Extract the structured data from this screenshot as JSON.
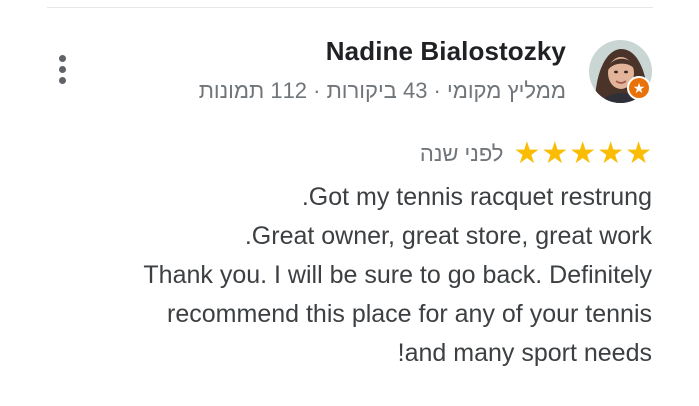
{
  "review": {
    "reviewer": {
      "name": "Nadine Bialostozky",
      "meta": "ממליץ מקומי · 43 ביקורות · 112 תמונות",
      "avatar_icon": "user-photo-icon",
      "badge_icon": "local-guide-star-icon"
    },
    "rating": {
      "stars": 5,
      "max": 5,
      "star_glyph": "★"
    },
    "time": "לפני שנה",
    "text_lines": [
      ".Got my tennis racquet restrung",
      ".Great owner, great store, great work",
      "Thank you. I will be sure to go back. Definitely",
      "recommend this place for any of your tennis",
      "!and many sport needs"
    ],
    "more_icon": "more-vert-icon"
  },
  "colors": {
    "star": "#fbbc04",
    "badge": "#e8710a",
    "meta": "#70757a",
    "text": "#3c4043"
  }
}
